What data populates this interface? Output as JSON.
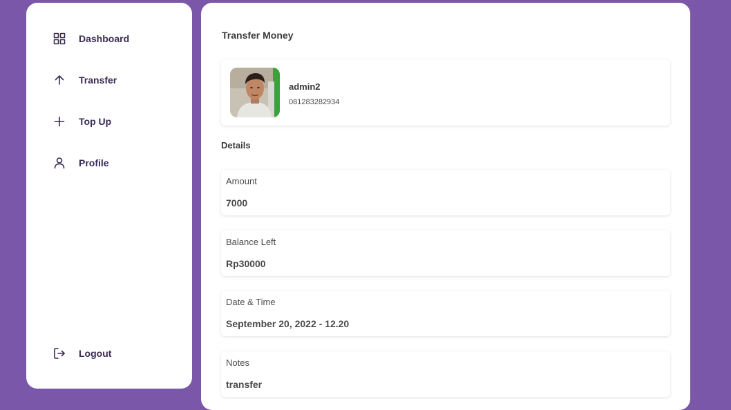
{
  "sidebar": {
    "items": [
      {
        "label": "Dashboard",
        "icon": "grid-icon"
      },
      {
        "label": "Transfer",
        "icon": "arrow-up-icon"
      },
      {
        "label": "Top Up",
        "icon": "plus-icon"
      },
      {
        "label": "Profile",
        "icon": "user-icon"
      }
    ],
    "logout": {
      "label": "Logout",
      "icon": "logout-icon"
    }
  },
  "main": {
    "title": "Transfer Money",
    "recipient": {
      "name": "admin2",
      "phone": "081283282934"
    },
    "details_title": "Details",
    "details": [
      {
        "label": "Amount",
        "value": "7000"
      },
      {
        "label": "Balance Left",
        "value": "Rp30000"
      },
      {
        "label": "Date & Time",
        "value": "September 20, 2022 - 12.20"
      },
      {
        "label": "Notes",
        "value": "transfer"
      }
    ]
  },
  "colors": {
    "background": "#7a57a8",
    "nav_text": "#3a2a55"
  }
}
